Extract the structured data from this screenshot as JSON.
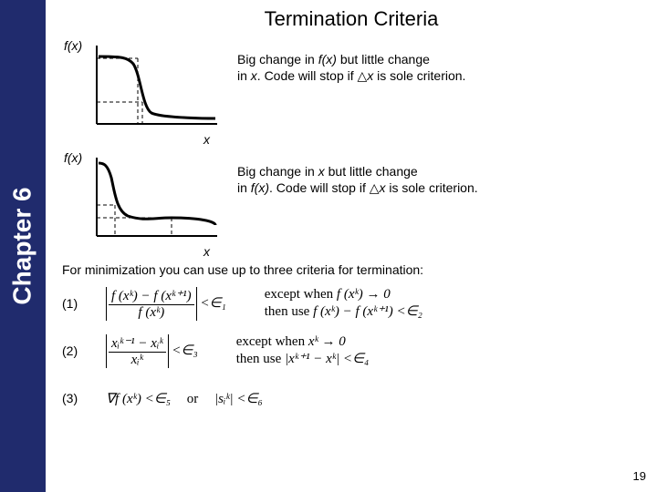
{
  "sidebar": {
    "chapter": "Chapter 6"
  },
  "title": "Termination Criteria",
  "graph1": {
    "fx": "f(x)",
    "x": "x",
    "text_a": "Big change in ",
    "text_b": "f(x)",
    "text_c": " but little change",
    "text_d": "in ",
    "text_e": "x",
    "text_f": ".  Code will stop if △",
    "text_g": "x",
    "text_h": " is sole criterion."
  },
  "graph2": {
    "fx": "f(x)",
    "x": "x",
    "text_a": "Big change in ",
    "text_b": "x",
    "text_c": " but little change",
    "text_d": "in ",
    "text_e": "f(x)",
    "text_f": ".  Code will stop if △",
    "text_g": "x",
    "text_h": " is sole criterion."
  },
  "body": "For minimization you can use up to three criteria for termination:",
  "criteria": {
    "c1": {
      "num": "(1)",
      "frac_num": "f (xᵏ) − f (xᵏ⁺¹)",
      "frac_den": "f (xᵏ)",
      "op": "<∈₁",
      "cond_a": "except when ",
      "cond_b": "f (xᵏ) → 0",
      "cond_c": "then use ",
      "cond_d": "f (xᵏ) − f (xᵏ⁺¹) <∈₂"
    },
    "c2": {
      "num": "(2)",
      "frac_num": "xᵢᵏ⁻¹ − xᵢᵏ",
      "frac_den": "xᵢᵏ",
      "op": "<∈₃",
      "cond_a": "except when ",
      "cond_b": "xᵏ → 0",
      "cond_c": "then use ",
      "cond_d": "|xᵏ⁺¹ − xᵏ| <∈₄"
    },
    "c3": {
      "num": "(3)",
      "expr_a": "∇f (xᵏ) <∈₅",
      "or": "or",
      "expr_b": "|sᵢᵏ| <∈₆"
    }
  },
  "pagenum": "19"
}
